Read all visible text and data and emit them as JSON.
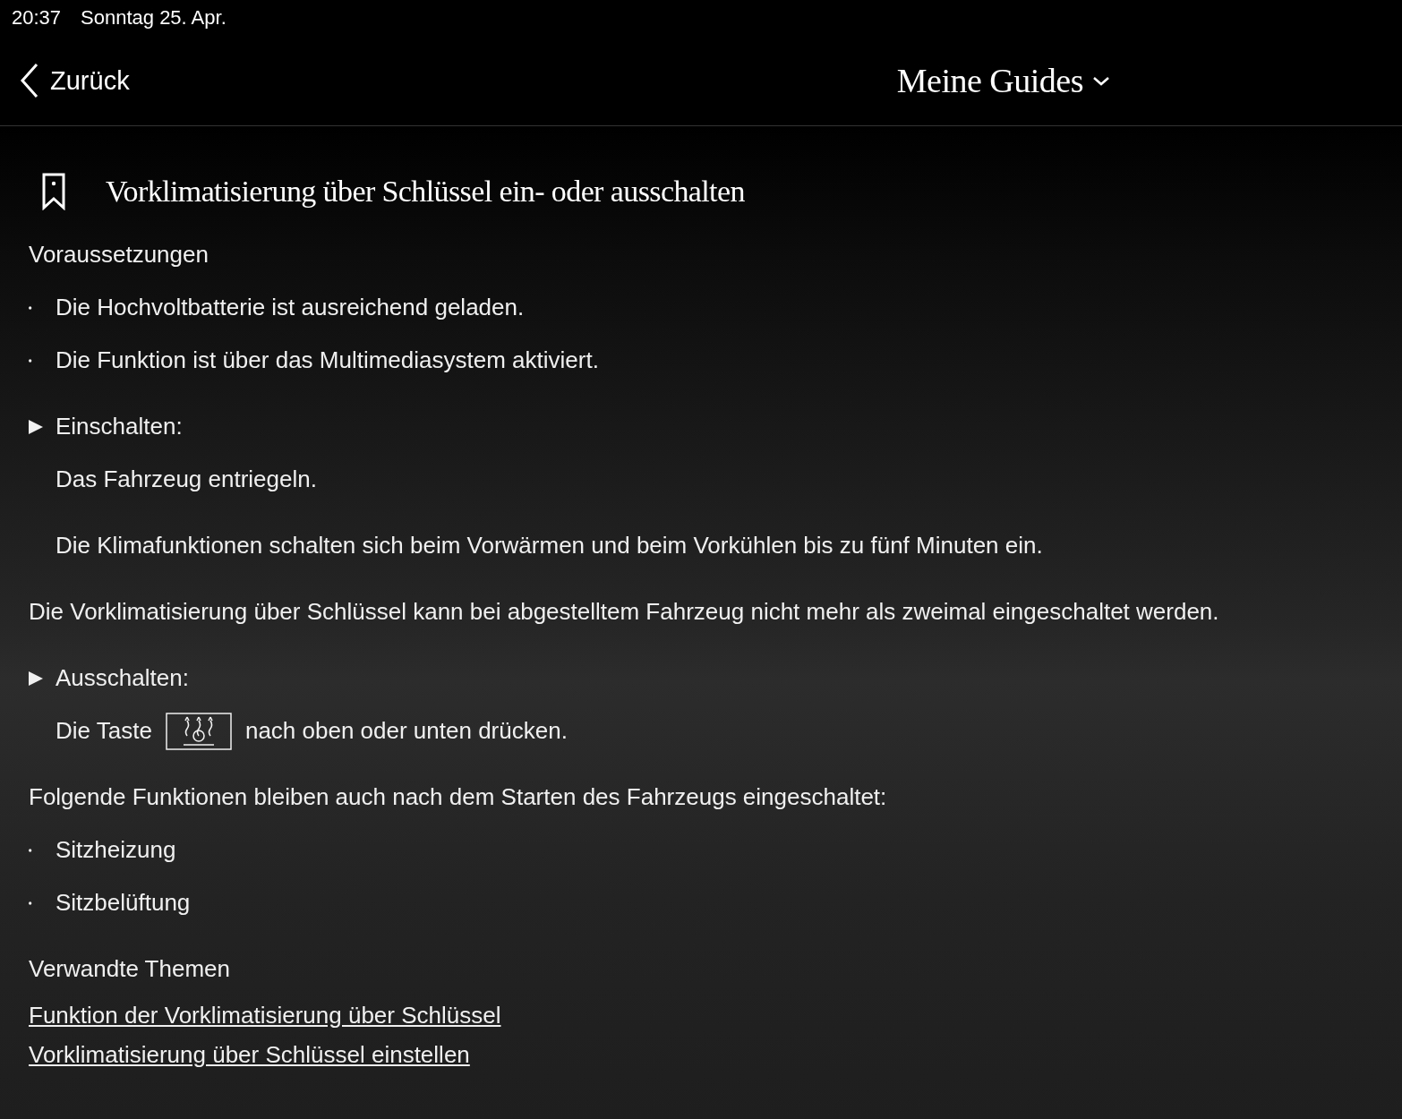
{
  "status_bar": {
    "time": "20:37",
    "date": "Sonntag 25. Apr."
  },
  "nav": {
    "back": "Zurück",
    "menu": "Meine Guides"
  },
  "article": {
    "title": "Vorklimatisierung über Schlüssel ein- oder ausschalten",
    "bookmarked": false,
    "blocks": [
      {
        "kind": "heading",
        "text": "Voraussetzungen"
      },
      {
        "kind": "bullet",
        "text": "Die Hochvoltbatterie ist ausreichend geladen."
      },
      {
        "kind": "bullet",
        "text": "Die Funktion ist über das Multimediasystem aktiviert."
      },
      {
        "kind": "step",
        "text": "Einschalten:"
      },
      {
        "kind": "indent",
        "text": "Das Fahrzeug entriegeln."
      },
      {
        "kind": "indent",
        "text": "Die Klimafunktionen schalten sich beim Vorwärmen und beim Vorkühlen bis zu fünf Minuten ein."
      },
      {
        "kind": "paragraph",
        "text": "Die Vorklimatisierung über Schlüssel kann bei abgestelltem Fahrzeug nicht mehr als zweimal eingeschaltet werden."
      },
      {
        "kind": "step",
        "text": "Ausschalten:"
      },
      {
        "kind": "key",
        "before": "Die Taste",
        "after": "nach oben oder unten drücken."
      },
      {
        "kind": "paragraph",
        "text": "Folgende Funktionen bleiben auch nach dem Starten des Fahrzeugs eingeschaltet:"
      },
      {
        "kind": "bullet",
        "text": "Sitzheizung"
      },
      {
        "kind": "bullet",
        "text": "Sitzbelüftung"
      },
      {
        "kind": "heading",
        "text": "Verwandte Themen"
      }
    ],
    "links": [
      "Funktion der Vorklimatisierung über Schlüssel",
      "Vorklimatisierung über Schlüssel einstellen"
    ]
  }
}
